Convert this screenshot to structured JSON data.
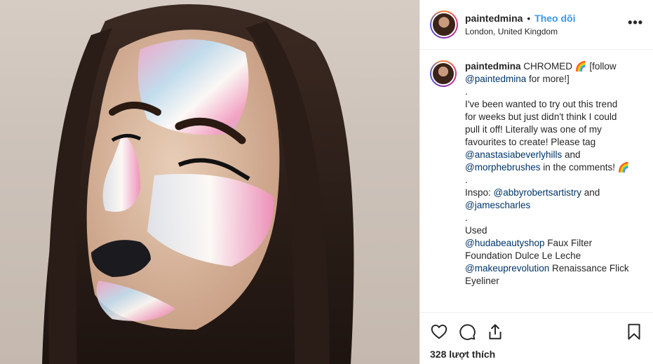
{
  "post": {
    "photo_alt": "",
    "header": {
      "username": "paintedmina",
      "separator": "•",
      "follow_label": "Theo dõi",
      "location": "London, United Kingdom",
      "more_label": "•••"
    },
    "caption": {
      "username": "paintedmina",
      "lines": [
        {
          "text": " CHROMED 🌈 [follow"
        },
        {
          "mention": "@paintedmina",
          "text": " for more!]"
        },
        {
          "text": "."
        },
        {
          "text": "I've been wanted to try out this trend"
        },
        {
          "text": "for weeks but just didn't think I could"
        },
        {
          "text": "pull it off! Literally was one of my"
        },
        {
          "text": "favourites to create! Please tag"
        },
        {
          "mention": "@anastasiabeverlyhills",
          "text": " and"
        },
        {
          "mention": "@morphebrushes",
          "text": " in the comments! 🌈"
        },
        {
          "text": "."
        },
        {
          "text": "Inspo: ",
          "mention": "@abbyrobertsartistry",
          "after": " and"
        },
        {
          "mention": "@jamescharles"
        },
        {
          "text": "."
        },
        {
          "text": "Used"
        },
        {
          "mention": "@hudabeautyshop",
          "text": " Faux Filter"
        },
        {
          "text": "Foundation Dulce Le Leche"
        },
        {
          "mention": "@makeuprevolution",
          "text": " Renaissance Flick"
        },
        {
          "text": "Eyeliner"
        }
      ]
    },
    "actions": {
      "like_icon": "heart-icon",
      "comment_icon": "comment-icon",
      "share_icon": "share-icon",
      "save_icon": "bookmark-icon"
    },
    "likes_text": "328 lượt thích",
    "colors": {
      "follow": "#3897f0",
      "mention": "#003569",
      "text": "#262626",
      "border": "#efefef"
    }
  }
}
